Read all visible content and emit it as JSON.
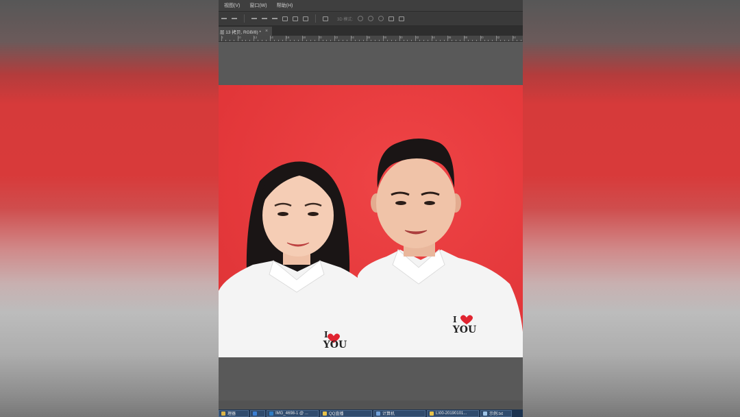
{
  "menu": {
    "items": [
      "视图(V)",
      "窗口(W)",
      "帮助(H)"
    ]
  },
  "options_bar": {
    "mode_3d_label": "3D 模式:"
  },
  "document": {
    "tab_label": "层 13 拷贝, RGB/8) *",
    "close_glyph": "×"
  },
  "ruler": {
    "ticks": [
      "8",
      "10",
      "12",
      "14",
      "16",
      "18",
      "20",
      "22",
      "24",
      "26",
      "28",
      "30",
      "32",
      "34",
      "36",
      "38",
      "40",
      "42",
      "44"
    ]
  },
  "photo": {
    "shirt_text_top": "I",
    "shirt_text_bottom": "YOU",
    "colors": {
      "background": "#e6393b",
      "shirt": "#f5f5f5",
      "hair": "#1a1515",
      "heart": "#e02430"
    }
  },
  "taskbar": {
    "items": [
      {
        "label": "理器",
        "icon_color": "#d9b44a"
      },
      {
        "label": "",
        "icon_color": "#3b7fd4"
      },
      {
        "label": "IMG_4698-1 @ ...",
        "icon_color": "#2d7cc4"
      },
      {
        "label": "QQ直播",
        "icon_color": "#e8c34a"
      },
      {
        "label": "计算机",
        "icon_color": "#6fa0d8"
      },
      {
        "label": "L\\00-20190101...",
        "icon_color": "#e8c34a"
      },
      {
        "label": "示例.txt",
        "icon_color": "#9ec4e8"
      }
    ]
  }
}
